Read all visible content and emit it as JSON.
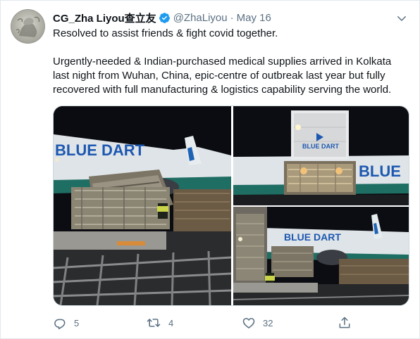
{
  "author": {
    "display_name": "CG_Zha Liyou查立友",
    "handle": "@ZhaLiyou",
    "separator": "·",
    "date": "May 16",
    "verified": true,
    "avatar_icon": "profile-avatar"
  },
  "tweet": {
    "paragraph_1": "Resolved to assist friends & fight covid together.",
    "paragraph_2": "Urgently-needed & Indian-purchased medical supplies arrived in Kolkata last night from Wuhan, China, epic-centre of outbreak last year but fully recovered with full manufacturing & logistics capability serving the world."
  },
  "media": {
    "photo_1_label": "BLUE DART",
    "photo_2_label": "BLUE DART",
    "photo_2_fuselage_label": "BLUE",
    "photo_3_label": "BLUE DART"
  },
  "actions": {
    "reply_count": "5",
    "retweet_count": "4",
    "like_count": "32",
    "icons": [
      "reply-icon",
      "retweet-icon",
      "like-icon",
      "share-icon"
    ],
    "icon_color": "#5b7083"
  },
  "colors": {
    "verified": "#1d9bf0",
    "text": "#0f1419",
    "secondary_text": "#5b7083",
    "border": "#cfd9de"
  }
}
